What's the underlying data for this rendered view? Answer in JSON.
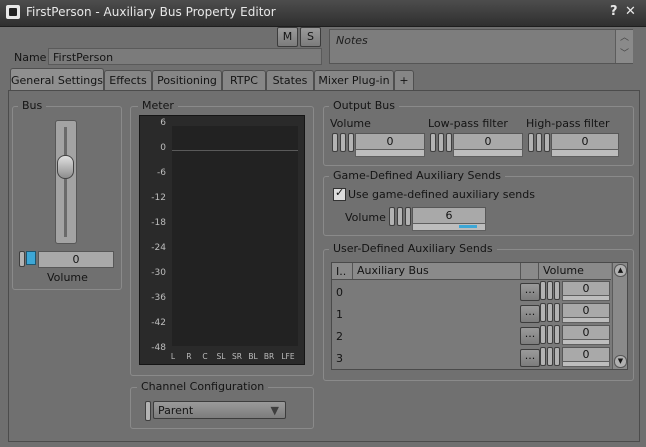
{
  "window": {
    "title": "FirstPerson - Auxiliary Bus Property Editor",
    "help_label": "?"
  },
  "header": {
    "mute_label": "M",
    "solo_label": "S",
    "name_label": "Name",
    "name_value": "FirstPerson",
    "notes_placeholder": "Notes"
  },
  "tabs": [
    {
      "label": "General Settings",
      "active": true
    },
    {
      "label": "Effects"
    },
    {
      "label": "Positioning"
    },
    {
      "label": "RTPC"
    },
    {
      "label": "States"
    },
    {
      "label": "Mixer Plug-in"
    },
    {
      "label": "+"
    }
  ],
  "bus": {
    "label": "Bus",
    "volume_value": "0",
    "volume_label": "Volume"
  },
  "meter": {
    "label": "Meter",
    "ticks": [
      "6",
      "0",
      "-6",
      "-12",
      "-18",
      "-24",
      "-30",
      "-36",
      "-42",
      "-48"
    ],
    "channels": [
      "L",
      "R",
      "C",
      "SL",
      "SR",
      "BL",
      "BR",
      "LFE"
    ]
  },
  "channel_config": {
    "label": "Channel Configuration",
    "value": "Parent"
  },
  "output_bus": {
    "label": "Output Bus",
    "volume": {
      "label": "Volume",
      "value": "0"
    },
    "lowpass": {
      "label": "Low-pass filter",
      "value": "0"
    },
    "highpass": {
      "label": "High-pass filter",
      "value": "0"
    }
  },
  "game_sends": {
    "label": "Game-Defined Auxiliary Sends",
    "checkbox_label": "Use game-defined auxiliary sends",
    "checked": true,
    "volume_label": "Volume",
    "volume_value": "6"
  },
  "user_sends": {
    "label": "User-Defined Auxiliary Sends",
    "columns": {
      "index": "I..",
      "bus": "Auxiliary Bus",
      "volume": "Volume"
    },
    "browse_label": "...",
    "rows": [
      {
        "index": "0",
        "bus": "",
        "volume": "0"
      },
      {
        "index": "1",
        "bus": "",
        "volume": "0"
      },
      {
        "index": "2",
        "bus": "",
        "volume": "0"
      },
      {
        "index": "3",
        "bus": "",
        "volume": "0"
      }
    ]
  },
  "colors": {
    "accent": "#3da7d6",
    "meter_bg": "#2a2a2a"
  }
}
